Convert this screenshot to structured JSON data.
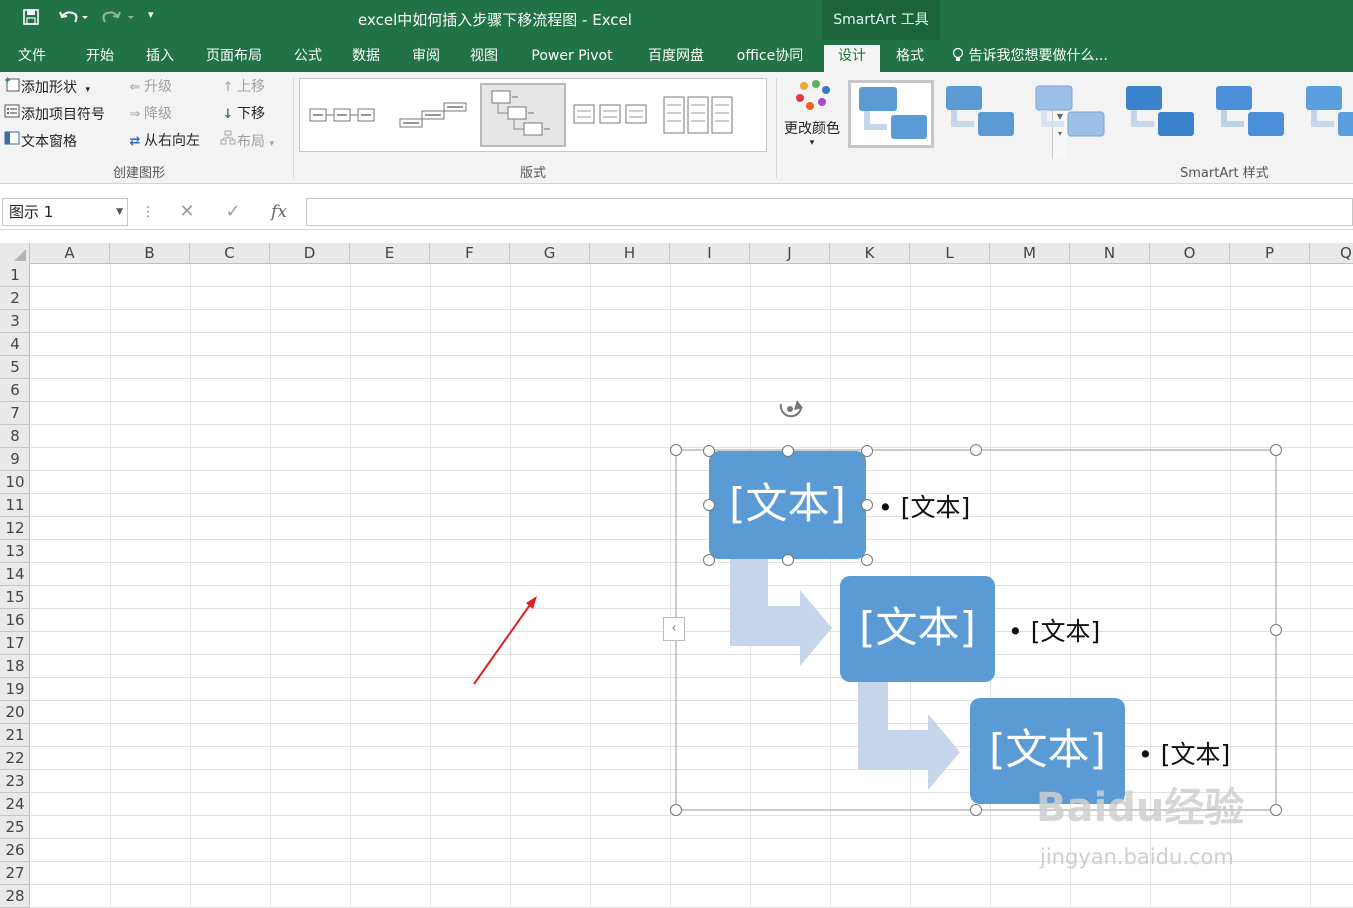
{
  "window": {
    "title": "excel中如何插入步骤下移流程图 - Excel",
    "contextual_tab_group": "SmartArt 工具"
  },
  "tabs": [
    {
      "label": "文件"
    },
    {
      "label": "开始"
    },
    {
      "label": "插入"
    },
    {
      "label": "页面布局"
    },
    {
      "label": "公式"
    },
    {
      "label": "数据"
    },
    {
      "label": "审阅"
    },
    {
      "label": "视图"
    },
    {
      "label": "Power Pivot"
    },
    {
      "label": "百度网盘"
    },
    {
      "label": "office协同"
    },
    {
      "label": "设计",
      "active": true
    },
    {
      "label": "格式"
    }
  ],
  "tell_me": "告诉我您想要做什么...",
  "ribbon": {
    "create_graphic": {
      "label": "创建图形",
      "add_shape": "添加形状",
      "add_bullet": "添加项目符号",
      "text_pane": "文本窗格",
      "promote": "升级",
      "demote": "降级",
      "right_to_left": "从右向左",
      "move_up": "上移",
      "move_down": "下移",
      "layout": "布局"
    },
    "layouts": {
      "label": "版式"
    },
    "change_colors": "更改颜色",
    "smartart_styles": {
      "label": "SmartArt 样式"
    }
  },
  "formula_bar": {
    "name_box": "图示 1",
    "fx_label": "fx",
    "value": ""
  },
  "columns": [
    "A",
    "B",
    "C",
    "D",
    "E",
    "F",
    "G",
    "H",
    "I",
    "J",
    "K",
    "L",
    "M",
    "N",
    "O",
    "P",
    "Q"
  ],
  "rows": [
    "1",
    "2",
    "3",
    "4",
    "5",
    "6",
    "7",
    "8",
    "9",
    "10",
    "11",
    "12",
    "13",
    "14",
    "15",
    "16",
    "17",
    "18",
    "19",
    "20",
    "21",
    "22",
    "23",
    "24",
    "25",
    "26",
    "27",
    "28"
  ],
  "smartart": {
    "nodes": [
      {
        "text": "[文本]",
        "bullet": "• [文本]"
      },
      {
        "text": "[文本]",
        "bullet": "• [文本]"
      },
      {
        "text": "[文本]",
        "bullet": "• [文本]"
      }
    ],
    "colors": {
      "node_fill": "#5b9bd5",
      "arrow_fill": "#c5d5ea"
    }
  },
  "watermark": {
    "text": "Baidu经验",
    "url_text": "jingyan.baidu.com"
  },
  "colors": {
    "accent": "#217346",
    "annotation_arrow": "#e02020"
  }
}
